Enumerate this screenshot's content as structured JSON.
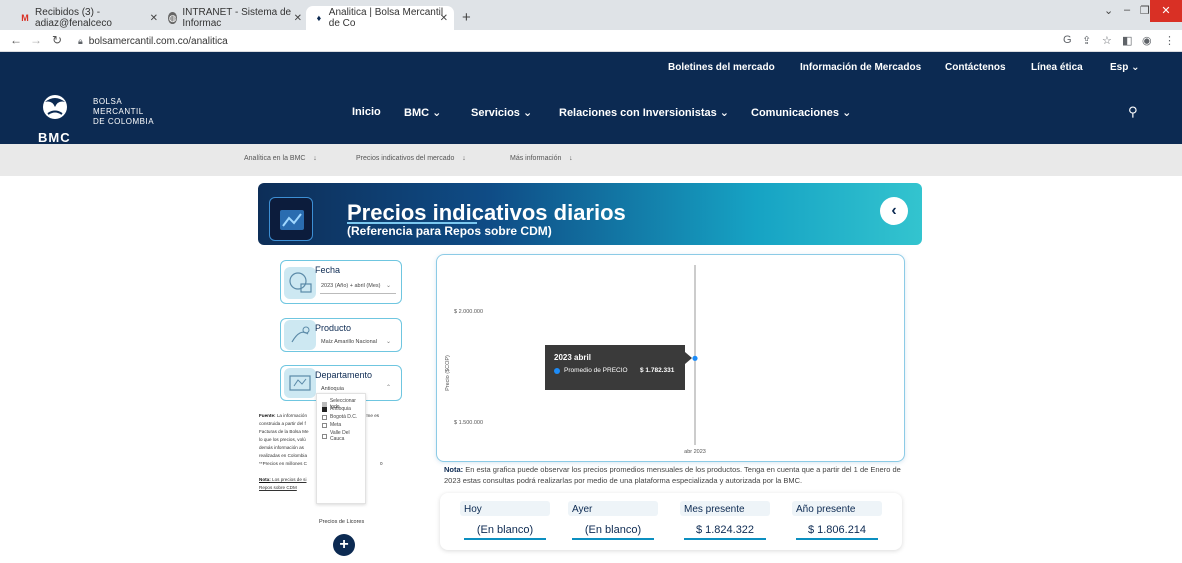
{
  "browser": {
    "tabs": [
      {
        "label": "Recibidos (3) - adiaz@fenalceco",
        "icon": "gmail-icon"
      },
      {
        "label": "INTRANET - Sistema de Informac",
        "icon": "globe-icon"
      },
      {
        "label": "Analitica | Bolsa Mercantil de Co",
        "icon": "bmc-icon"
      }
    ],
    "url": "bolsamercantil.com.co/analitica",
    "new_tab": "+"
  },
  "header": {
    "top_links": [
      "Boletines del mercado",
      "Información de Mercados",
      "Contáctenos",
      "Línea ética",
      "Esp"
    ],
    "logo_text": [
      "BOLSA",
      "MERCANTIL",
      "DE COLOMBIA"
    ],
    "logo_abbr": "BMC",
    "nav": [
      "Inicio",
      "BMC",
      "Servicios",
      "Relaciones con Inversionistas",
      "Comunicaciones"
    ]
  },
  "subnav": [
    "Analítica en la BMC",
    "Precios indicativos del mercado",
    "Más información"
  ],
  "report": {
    "title": "Precios indicativos diarios",
    "subtitle": "(Referencia para Repos sobre CDM)"
  },
  "filters": {
    "fecha": {
      "label": "Fecha",
      "value": "2023 (Año) + abril (Mes)"
    },
    "producto": {
      "label": "Producto",
      "value": "Maíz Amarillo Nacional"
    },
    "departamento": {
      "label": "Departamento",
      "value": "Antioquia",
      "options": [
        "Seleccionar todo",
        "Antioquia",
        "Bogotá D.C.",
        "Meta",
        "Valle Del Cauca"
      ],
      "checked": [
        false,
        true,
        false,
        false,
        false
      ]
    }
  },
  "note_left": {
    "l1a": "Fuente:",
    "l1b": " La información",
    "l1c": "rme es",
    "l2": "construida a partir del f",
    "l3": "Facturas de la Bolsa Me",
    "l4": "lo que los precios, volú",
    "l5": "demás información as",
    "l6": "realizadas en Colombia",
    "l7": "**Precios en millones C",
    "l7b": "0",
    "n1a": "Nota:",
    "n1b": " Los precios de si",
    "n1c": "ntes para",
    "n2": "Repos sobre CDM"
  },
  "licores": {
    "label": "Precios de Licores",
    "button": "+"
  },
  "chart_data": {
    "type": "line",
    "ylabel": "Precio ($COP)",
    "y_ticks": [
      "$ 2.000.000",
      "$ 1.500.000"
    ],
    "x_ticks": [
      "abr 2023"
    ],
    "x": [
      "abr 2023"
    ],
    "series": [
      {
        "name": "Promedio de PRECIO",
        "values": [
          1782331
        ]
      }
    ],
    "tooltip": {
      "title": "2023 abril",
      "series": "Promedio de PRECIO",
      "value": "$ 1.782.331"
    },
    "y_range": [
      1500000,
      2000000
    ],
    "color": "#1d8cf8"
  },
  "note_bottom": {
    "bold": "Nota:",
    "text": " En esta grafica puede observar los precios promedios mensuales de los productos. Tenga en cuenta que a partir del 1 de Enero de 2023 estas consultas podrá realizarlas por medio de una plataforma especializada y autorizada por la BMC."
  },
  "kpis": [
    {
      "label": "Hoy",
      "value": "(En blanco)"
    },
    {
      "label": "Ayer",
      "value": "(En blanco)"
    },
    {
      "label": "Mes presente",
      "value": "$ 1.824.322"
    },
    {
      "label": "Año presente",
      "value": "$ 1.806.214"
    }
  ],
  "colors": {
    "navy": "#0c2a52",
    "accent": "#16a3c4",
    "point": "#1d8cf8"
  }
}
